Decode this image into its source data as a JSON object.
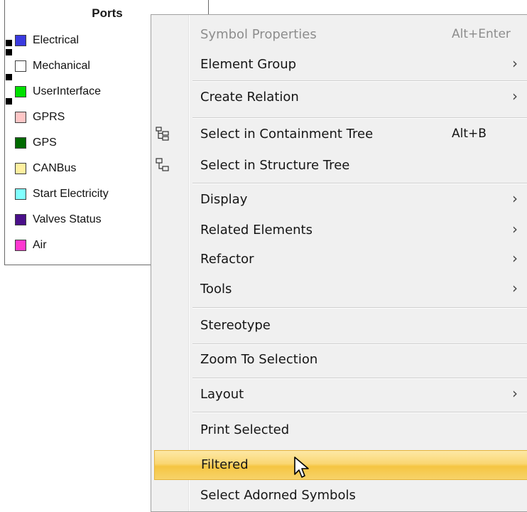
{
  "ports_panel": {
    "title": "Ports",
    "items": [
      {
        "label": "Electrical",
        "color": "#3a3adf"
      },
      {
        "label": "Mechanical",
        "color": "#ffffff"
      },
      {
        "label": "UserInterface",
        "color": "#00e000"
      },
      {
        "label": "GPRS",
        "color": "#ffc6c6"
      },
      {
        "label": "GPS",
        "color": "#006a00"
      },
      {
        "label": "CANBus",
        "color": "#fff0a0"
      },
      {
        "label": "Start Electricity",
        "color": "#80ffff"
      },
      {
        "label": "Valves Status",
        "color": "#4a108a"
      },
      {
        "label": "Air",
        "color": "#ff38d0"
      }
    ]
  },
  "context_menu": {
    "items": [
      {
        "label": "Symbol Properties",
        "shortcut": "Alt+Enter",
        "disabled": true
      },
      {
        "label": "Element Group",
        "submenu": true
      },
      {
        "label": "Create Relation",
        "submenu": true
      },
      {
        "label": "Select in Containment Tree",
        "shortcut": "Alt+B",
        "icon": "containment-tree-icon"
      },
      {
        "label": "Select in Structure Tree",
        "icon": "structure-tree-icon"
      },
      {
        "label": "Display",
        "submenu": true
      },
      {
        "label": "Related Elements",
        "submenu": true
      },
      {
        "label": "Refactor",
        "submenu": true
      },
      {
        "label": "Tools",
        "submenu": true
      },
      {
        "label": "Stereotype"
      },
      {
        "label": "Zoom To Selection"
      },
      {
        "label": "Layout",
        "submenu": true
      },
      {
        "label": "Print Selected"
      },
      {
        "label": "Filtered",
        "highlighted": true
      },
      {
        "label": "Select Adorned Symbols"
      }
    ],
    "arrow_glyph": "›",
    "highlight_color": "#fad773"
  }
}
